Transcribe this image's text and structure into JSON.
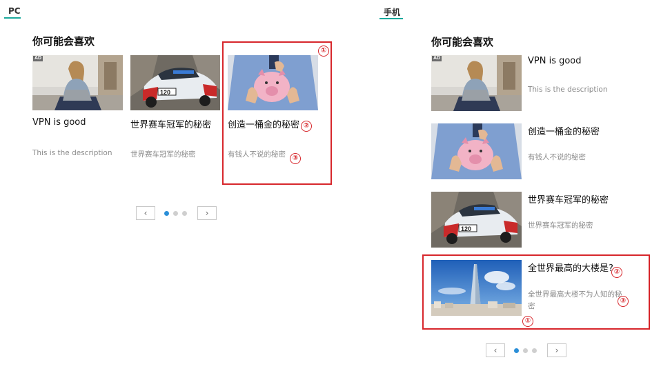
{
  "tabs": {
    "pc": "PC",
    "mobile": "手机"
  },
  "pc": {
    "section_title": "你可能会喜欢",
    "cards": [
      {
        "ad": "AD",
        "title": "VPN is good",
        "desc": "This is the description"
      },
      {
        "title": "世界赛车冠军的秘密",
        "desc": "世界赛车冠军的秘密"
      },
      {
        "title": "创造一桶金的秘密",
        "desc": "有钱人不说的秘密"
      }
    ],
    "pager": {
      "prev": "‹",
      "next": "›",
      "page_count": 3,
      "active_page": 1
    }
  },
  "mobile": {
    "section_title": "你可能会喜欢",
    "cards": [
      {
        "ad": "AD",
        "title": "VPN is good",
        "desc": "This is the description"
      },
      {
        "title": "创造一桶金的秘密",
        "desc": "有钱人不说的秘密"
      },
      {
        "title": "世界赛车冠军的秘密",
        "desc": "世界赛车冠军的秘密"
      },
      {
        "title": "全世界最高的大楼是?",
        "desc": "全世界最高大楼不为人知的秘密"
      }
    ],
    "pager": {
      "prev": "‹",
      "next": "›",
      "page_count": 3,
      "active_page": 1
    }
  },
  "markers": {
    "one": "①",
    "two": "②",
    "three": "③"
  },
  "colors": {
    "accent": "#1aa99c",
    "highlight": "#d7262b",
    "dot_active": "#2b8fd8"
  }
}
